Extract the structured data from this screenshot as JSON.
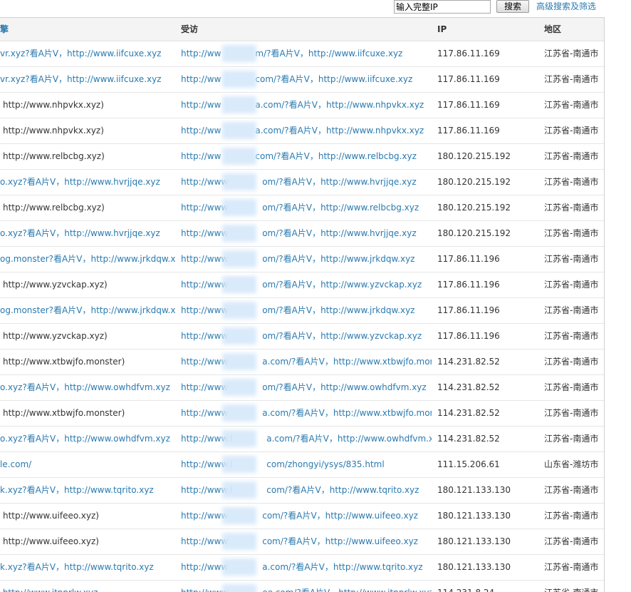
{
  "toolbar": {
    "ip_input_value": "输入完整IP",
    "search_label": "搜索",
    "advanced_label": "高级搜索及筛选"
  },
  "table": {
    "headers": {
      "engine": "擎",
      "visit": "受访",
      "ip": "IP",
      "region": "地区"
    },
    "rows": [
      {
        "engine": "vr.xyz?看A片V，http://www.iifcuxe.xyz",
        "engine_link": true,
        "visit_pre": "http://ww",
        "visit_post": "m/?看A片V，http://www.iifcuxe.xyz",
        "ip": "117.86.11.169",
        "region": "江苏省-南通市"
      },
      {
        "engine": "vr.xyz?看A片V，http://www.iifcuxe.xyz",
        "engine_link": true,
        "visit_pre": "http://ww",
        "visit_post": "com/?看A片V，http://www.iifcuxe.xyz",
        "ip": "117.86.11.169",
        "region": "江苏省-南通市"
      },
      {
        "engine": "http://www.nhpvkx.xyz)",
        "engine_link": false,
        "visit_pre": "http://ww",
        "visit_post": "a.com/?看A片V，http://www.nhpvkx.xyz",
        "ip": "117.86.11.169",
        "region": "江苏省-南通市"
      },
      {
        "engine": "http://www.nhpvkx.xyz)",
        "engine_link": false,
        "visit_pre": "http://ww",
        "visit_post": "a.com/?看A片V，http://www.nhpvkx.xyz",
        "ip": "117.86.11.169",
        "region": "江苏省-南通市"
      },
      {
        "engine": "http://www.relbcbg.xyz)",
        "engine_link": false,
        "visit_pre": "http://ww",
        "visit_post": "com/?看A片V，http://www.relbcbg.xyz",
        "ip": "180.120.215.192",
        "region": "江苏省-南通市"
      },
      {
        "engine": "o.xyz?看A片V，http://www.hvrjjqe.xyz",
        "engine_link": true,
        "visit_pre": "http://www",
        "visit_post": "om/?看A片V，http://www.hvrjjqe.xyz",
        "ip": "180.120.215.192",
        "region": "江苏省-南通市"
      },
      {
        "engine": "http://www.relbcbg.xyz)",
        "engine_link": false,
        "visit_pre": "http://www",
        "visit_post": "om/?看A片V，http://www.relbcbg.xyz",
        "ip": "180.120.215.192",
        "region": "江苏省-南通市"
      },
      {
        "engine": "o.xyz?看A片V，http://www.hvrjjqe.xyz",
        "engine_link": true,
        "visit_pre": "http://www",
        "visit_post": "om/?看A片V，http://www.hvrjjqe.xyz",
        "ip": "180.120.215.192",
        "region": "江苏省-南通市"
      },
      {
        "engine": "og.monster?看A片V，http://www.jrkdqw.xy",
        "engine_link": true,
        "visit_pre": "http://www",
        "visit_post": "om/?看A片V，http://www.jrkdqw.xyz",
        "ip": "117.86.11.196",
        "region": "江苏省-南通市"
      },
      {
        "engine": "http://www.yzvckap.xyz)",
        "engine_link": false,
        "visit_pre": "http://www",
        "visit_post": "om/?看A片V，http://www.yzvckap.xyz",
        "ip": "117.86.11.196",
        "region": "江苏省-南通市"
      },
      {
        "engine": "og.monster?看A片V，http://www.jrkdqw.xy",
        "engine_link": true,
        "visit_pre": "http://www",
        "visit_post": "om/?看A片V，http://www.jrkdqw.xyz",
        "ip": "117.86.11.196",
        "region": "江苏省-南通市"
      },
      {
        "engine": "http://www.yzvckap.xyz)",
        "engine_link": false,
        "visit_pre": "http://www",
        "visit_post": "om/?看A片V，http://www.yzvckap.xyz",
        "ip": "117.86.11.196",
        "region": "江苏省-南通市"
      },
      {
        "engine": "http://www.xtbwjfo.monster)",
        "engine_link": false,
        "visit_pre": "http://www",
        "visit_post": "a.com/?看A片V，http://www.xtbwjfo.monste",
        "ip": "114.231.82.52",
        "region": "江苏省-南通市"
      },
      {
        "engine": "o.xyz?看A片V，http://www.owhdfvm.xyz",
        "engine_link": true,
        "visit_pre": "http://www",
        "visit_post": "om/?看A片V，http://www.owhdfvm.xyz",
        "ip": "114.231.82.52",
        "region": "江苏省-南通市"
      },
      {
        "engine": "http://www.xtbwjfo.monster)",
        "engine_link": false,
        "visit_pre": "http://www",
        "visit_post": "a.com/?看A片V，http://www.xtbwjfo.monste",
        "ip": "114.231.82.52",
        "region": "江苏省-南通市"
      },
      {
        "engine": "o.xyz?看A片V，http://www.owhdfvm.xyz",
        "engine_link": true,
        "visit_pre": "http://www.l",
        "visit_post": "a.com/?看A片V，http://www.owhdfvm.xyz",
        "ip": "114.231.82.52",
        "region": "江苏省-南通市"
      },
      {
        "engine": "le.com/",
        "engine_link": true,
        "visit_pre": "http://www.l",
        "visit_post": "com/zhongyi/ysys/835.html",
        "ip": "111.15.206.61",
        "region": "山东省-潍坊市"
      },
      {
        "engine": "k.xyz?看A片V，http://www.tqrito.xyz",
        "engine_link": true,
        "visit_pre": "http://www.l",
        "visit_post": "com/?看A片V，http://www.tqrito.xyz",
        "ip": "180.121.133.130",
        "region": "江苏省-南通市"
      },
      {
        "engine": "http://www.uifeeo.xyz)",
        "engine_link": false,
        "visit_pre": "http://www",
        "visit_post": "com/?看A片V，http://www.uifeeo.xyz",
        "ip": "180.121.133.130",
        "region": "江苏省-南通市"
      },
      {
        "engine": "http://www.uifeeo.xyz)",
        "engine_link": false,
        "visit_pre": "http://www",
        "visit_post": "com/?看A片V，http://www.uifeeo.xyz",
        "ip": "180.121.133.130",
        "region": "江苏省-南通市"
      },
      {
        "engine": "k.xyz?看A片V，http://www.tqrito.xyz",
        "engine_link": true,
        "visit_pre": "http://www",
        "visit_post": "a.com/?看A片V，http://www.tqrito.xyz",
        "ip": "180.121.133.130",
        "region": "江苏省-南通市"
      },
      {
        "engine": "·http://www.itnnrlw.xyz",
        "engine_link": true,
        "visit_pre": "http://www",
        "visit_post": "ee.com/?看A片V，http://www.itnnrlw.xyz",
        "ip": "114.231.8.24",
        "region": "江苏省-南通市"
      }
    ]
  }
}
